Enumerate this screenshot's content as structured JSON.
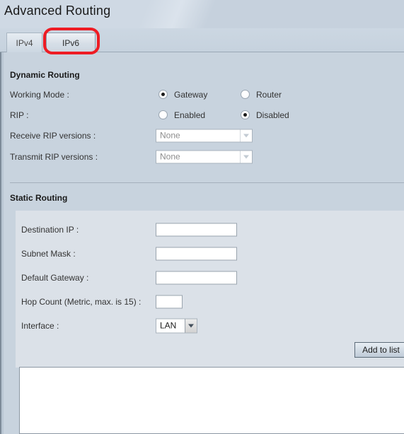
{
  "page": {
    "title": "Advanced Routing"
  },
  "tabs": [
    {
      "label": "IPv4",
      "active": false
    },
    {
      "label": "IPv6",
      "active": true
    }
  ],
  "annotation": {
    "color": "#ee1c24",
    "target": "IPv6"
  },
  "dynamic_routing": {
    "heading": "Dynamic Routing",
    "working_mode": {
      "label": "Working Mode :",
      "options": [
        {
          "label": "Gateway",
          "selected": true
        },
        {
          "label": "Router",
          "selected": false
        }
      ]
    },
    "rip": {
      "label": "RIP :",
      "options": [
        {
          "label": "Enabled",
          "selected": false
        },
        {
          "label": "Disabled",
          "selected": true
        }
      ]
    },
    "receive_rip_versions": {
      "label": "Receive RIP versions :",
      "value": "None",
      "disabled": true
    },
    "transmit_rip_versions": {
      "label": "Transmit RIP versions :",
      "value": "None",
      "disabled": true
    }
  },
  "static_routing": {
    "heading": "Static Routing",
    "destination_ip": {
      "label": "Destination IP :",
      "value": ""
    },
    "subnet_mask": {
      "label": "Subnet Mask :",
      "value": ""
    },
    "default_gateway": {
      "label": "Default Gateway :",
      "value": ""
    },
    "hop_count": {
      "label": "Hop Count (Metric, max. is 15) :",
      "value": ""
    },
    "interface": {
      "label": "Interface :",
      "value": "LAN",
      "disabled": false
    },
    "add_to_list_button": "Add to list",
    "route_list": {
      "rows": []
    }
  },
  "colors": {
    "page_background": "#c8d3de",
    "inner_panel": "#dbe1e8",
    "annotation_red": "#ee1c24",
    "border": "#9aa6b2"
  }
}
